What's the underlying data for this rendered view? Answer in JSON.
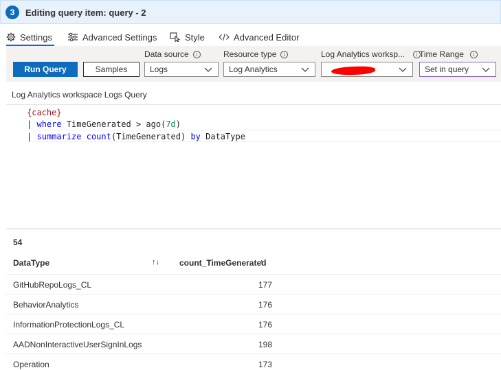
{
  "header": {
    "step": "3",
    "title": "Editing query item: query - 2"
  },
  "tabs": [
    {
      "label": "Settings",
      "icon": "gear-icon",
      "active": true
    },
    {
      "label": "Advanced Settings",
      "icon": "sliders-icon",
      "active": false
    },
    {
      "label": "Style",
      "icon": "cursor-icon",
      "active": false
    },
    {
      "label": "Advanced Editor",
      "icon": "code-icon",
      "active": false
    }
  ],
  "toolbar": {
    "run_label": "Run Query",
    "samples_label": "Samples",
    "data_source": {
      "label": "Data source",
      "value": "Logs"
    },
    "resource_type": {
      "label": "Resource type",
      "value": "Log Analytics"
    },
    "workspace": {
      "label": "Log Analytics worksp...",
      "value": ""
    },
    "time_range": {
      "label": "Time Range",
      "value": "Set in query"
    }
  },
  "query": {
    "title": "Log Analytics workspace Logs Query",
    "lines": [
      "{cache}",
      "| where TimeGenerated > ago(7d)",
      "| summarize count(TimeGenerated) by DataType"
    ]
  },
  "results": {
    "count": "54",
    "columns": [
      "DataType",
      "count_TimeGenerated"
    ],
    "rows": [
      {
        "name": "GitHubRepoLogs_CL",
        "value": "177"
      },
      {
        "name": "BehaviorAnalytics",
        "value": "176"
      },
      {
        "name": "InformationProtectionLogs_CL",
        "value": "176"
      },
      {
        "name": "AADNonInteractiveUserSignInLogs",
        "value": "198"
      },
      {
        "name": "Operation",
        "value": "173"
      }
    ]
  },
  "colors": {
    "accent": "#0f6cbd",
    "header_bg": "#e8f2fd",
    "time_range_border": "#8764b8",
    "redaction": "#ff0000"
  }
}
